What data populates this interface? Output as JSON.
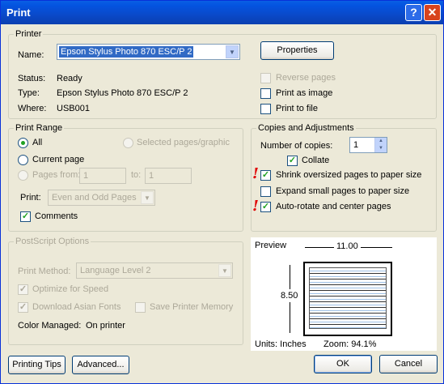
{
  "window": {
    "title": "Print",
    "help_label": "?",
    "close_label": "✕"
  },
  "printer": {
    "legend": "Printer",
    "name_label": "Name:",
    "name_value": "Epson Stylus Photo 870 ESC/P 2",
    "properties_label": "Properties",
    "status_label": "Status:",
    "status_value": "Ready",
    "type_label": "Type:",
    "type_value": "Epson Stylus Photo 870 ESC/P 2",
    "where_label": "Where:",
    "where_value": "USB001",
    "reverse_pages": "Reverse pages",
    "print_as_image": "Print as image",
    "print_to_file": "Print to file"
  },
  "print_range": {
    "legend": "Print Range",
    "all": "All",
    "selected": "Selected pages/graphic",
    "current_page": "Current page",
    "pages_from": "Pages from:",
    "from_value": "1",
    "to_label": "to:",
    "to_value": "1",
    "print_label": "Print:",
    "print_value": "Even and Odd Pages",
    "comments": "Comments"
  },
  "copies": {
    "legend": "Copies and Adjustments",
    "number_label": "Number of copies:",
    "number_value": "1",
    "collate": "Collate",
    "shrink": "Shrink oversized pages to paper size",
    "expand": "Expand small pages to paper size",
    "autorotate": "Auto-rotate and center pages",
    "warning_mark": "!"
  },
  "postscript": {
    "legend": "PostScript Options",
    "method_label": "Print Method:",
    "method_value": "Language Level 2",
    "optimize": "Optimize for Speed",
    "download_fonts": "Download Asian Fonts",
    "save_memory": "Save Printer Memory",
    "color_managed_label": "Color Managed:",
    "color_managed_value": "On printer"
  },
  "preview": {
    "legend": "Preview",
    "width": "11.00",
    "height": "8.50",
    "units": "Units: Inches",
    "zoom": "Zoom: 94.1%"
  },
  "buttons": {
    "printing_tips": "Printing Tips",
    "advanced": "Advanced...",
    "ok": "OK",
    "cancel": "Cancel"
  },
  "colors": {
    "title_bar": "#0a49c9",
    "selection": "#316ac5",
    "check": "#21a121",
    "warning": "#e00000"
  }
}
